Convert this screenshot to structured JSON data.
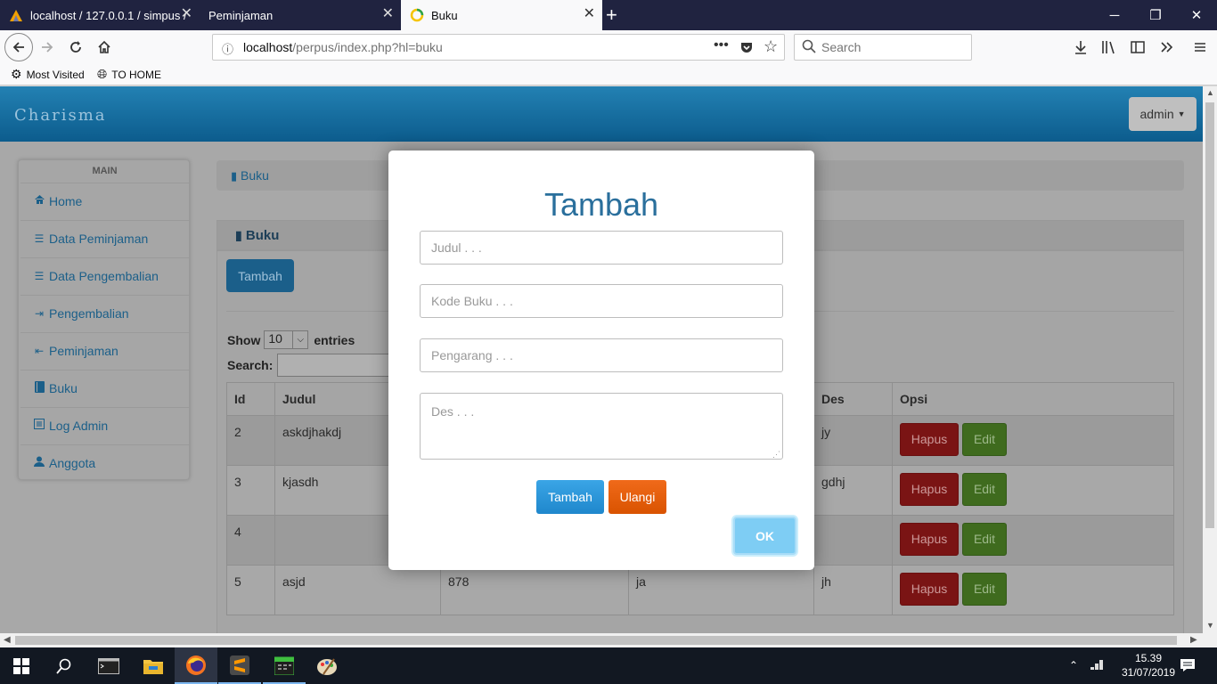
{
  "browser": {
    "tabs": [
      {
        "label": "localhost / 127.0.0.1 / simpus /",
        "active": false
      },
      {
        "label": "Peminjaman",
        "active": false
      },
      {
        "label": "Buku",
        "active": true
      }
    ],
    "url_host": "localhost",
    "url_path": "/perpus/index.php?hl=buku",
    "search_placeholder": "Search",
    "bookmarks": [
      "Most Visited",
      "TO HOME"
    ]
  },
  "app": {
    "brand": "Charisma",
    "user_menu": "admin"
  },
  "sidebar": {
    "section": "MAIN",
    "items": [
      {
        "label": "Home",
        "icon": "home-icon"
      },
      {
        "label": "Data Peminjaman",
        "icon": "list-icon"
      },
      {
        "label": "Data Pengembalian",
        "icon": "list-icon"
      },
      {
        "label": "Pengembalian",
        "icon": "sign-in-icon"
      },
      {
        "label": "Peminjaman",
        "icon": "sign-out-icon"
      },
      {
        "label": "Buku",
        "icon": "book-icon"
      },
      {
        "label": "Log Admin",
        "icon": "list-alt-icon"
      },
      {
        "label": "Anggota",
        "icon": "user-icon"
      }
    ]
  },
  "main": {
    "breadcrumb": "Buku",
    "box_title": "Buku",
    "add_button": "Tambah",
    "show_label": "Show",
    "show_value": "10",
    "entries_label": "entries",
    "search_label": "Search:",
    "table": {
      "columns": [
        "Id",
        "Judul",
        "",
        "",
        "Des",
        "Opsi"
      ],
      "rows": [
        {
          "id": "2",
          "judul": "askdjhakdj",
          "kode": "",
          "pengarang": "",
          "des": "jy"
        },
        {
          "id": "3",
          "judul": "kjasdh",
          "kode": "",
          "pengarang": "",
          "des": "gdhj"
        },
        {
          "id": "4",
          "judul": "",
          "kode": "",
          "pengarang": "",
          "des": ""
        },
        {
          "id": "5",
          "judul": "asjd",
          "kode": "878",
          "pengarang": "ja",
          "des": "jh"
        }
      ],
      "delete_label": "Hapus",
      "edit_label": "Edit"
    }
  },
  "modal": {
    "title": "Tambah",
    "judul_placeholder": "Judul . . .",
    "kode_placeholder": "Kode Buku . . .",
    "pengarang_placeholder": "Pengarang . . .",
    "des_placeholder": "Des . . .",
    "submit_label": "Tambah",
    "reset_label": "Ulangi",
    "ok_label": "OK"
  },
  "taskbar": {
    "time": "15.39",
    "date": "31/07/2019"
  }
}
